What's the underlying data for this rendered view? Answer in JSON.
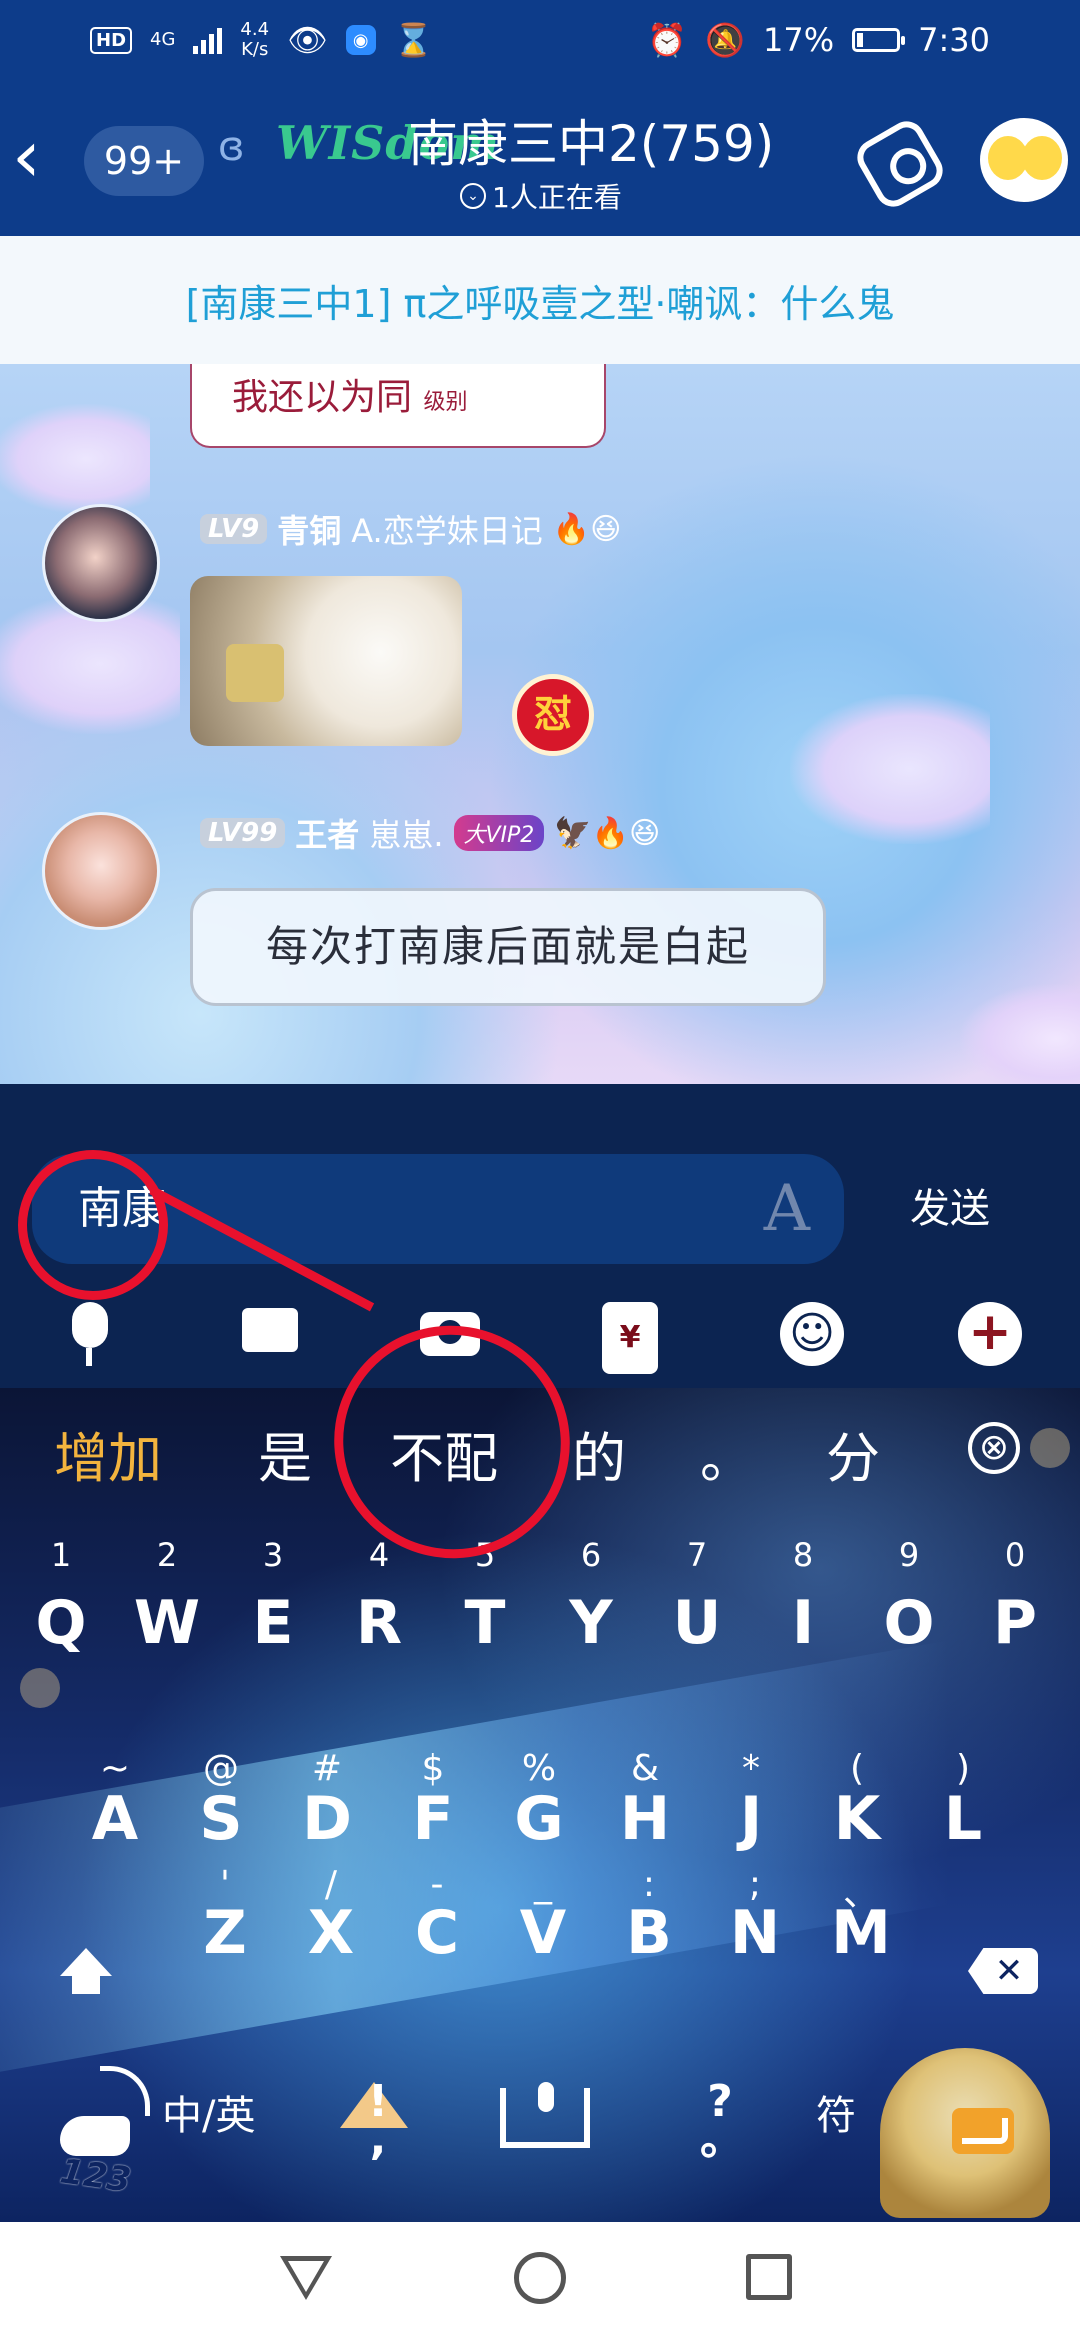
{
  "status_bar": {
    "hd": "HD",
    "network": "4G",
    "speed_value": "4.4",
    "speed_unit": "K/s",
    "battery": "17%",
    "time": "7:30",
    "battery_level": 0.17
  },
  "header": {
    "unread_count": "99+",
    "logo_text": "WISdom",
    "title": "南康三中2(759)",
    "viewing": "1人正在看"
  },
  "notice": {
    "text": "[南康三中1] π之呼吸壹之型·嘲讽：什么鬼"
  },
  "chat": {
    "prev_image_text": "我还以为同",
    "prev_image_text_small": "级别",
    "messages": [
      {
        "level": "LV9",
        "rank": "青铜",
        "rank_color": "#ffffff",
        "nickname": "A.恋学妹日记",
        "emojis": "🔥😆",
        "type": "sticker"
      },
      {
        "level": "LV99",
        "rank": "王者",
        "rank_color": "#ffffff",
        "nickname": "崽崽.",
        "vip": "大VIP2",
        "emojis": "🦅🔥😆",
        "type": "text",
        "text": "每次打南康后面就是白起"
      }
    ],
    "badge_char": "怼"
  },
  "input": {
    "value": "南康",
    "send_label": "发送",
    "redpack_symbol": "¥",
    "emoji_symbol": "☺",
    "plus_symbol": "+"
  },
  "keyboard": {
    "candidates": [
      "增加",
      "是",
      "不配",
      "的",
      "。",
      "分"
    ],
    "close_symbol": "⊗",
    "numbers": [
      "1",
      "2",
      "3",
      "4",
      "5",
      "6",
      "7",
      "8",
      "9",
      "0"
    ],
    "row1": [
      "Q",
      "W",
      "E",
      "R",
      "T",
      "Y",
      "U",
      "I",
      "O",
      "P"
    ],
    "row2_hints": [
      "~",
      "@",
      "#",
      "$",
      "%",
      "&",
      "*",
      "(",
      ")"
    ],
    "row2": [
      "A",
      "S",
      "D",
      "F",
      "G",
      "H",
      "J",
      "K",
      "L"
    ],
    "row3_hints": [
      "'",
      "/",
      "-",
      "_",
      ":",
      ";",
      "、"
    ],
    "row3": [
      "Z",
      "X",
      "C",
      "V",
      "B",
      "N",
      "M"
    ],
    "num_switch_label": "123",
    "lang_label": "中/英",
    "punct_label_top": "!",
    "punct_label_bottom": ",",
    "question_label_top": "?",
    "question_label_bottom": "。",
    "symbol_label": "符",
    "delete_symbol": "✕"
  },
  "colors": {
    "header_bg": "#0d3c8a",
    "notice_text": "#1f9fd6",
    "first_candidate": "#f3b43e",
    "annotation_red": "#e8112d"
  }
}
